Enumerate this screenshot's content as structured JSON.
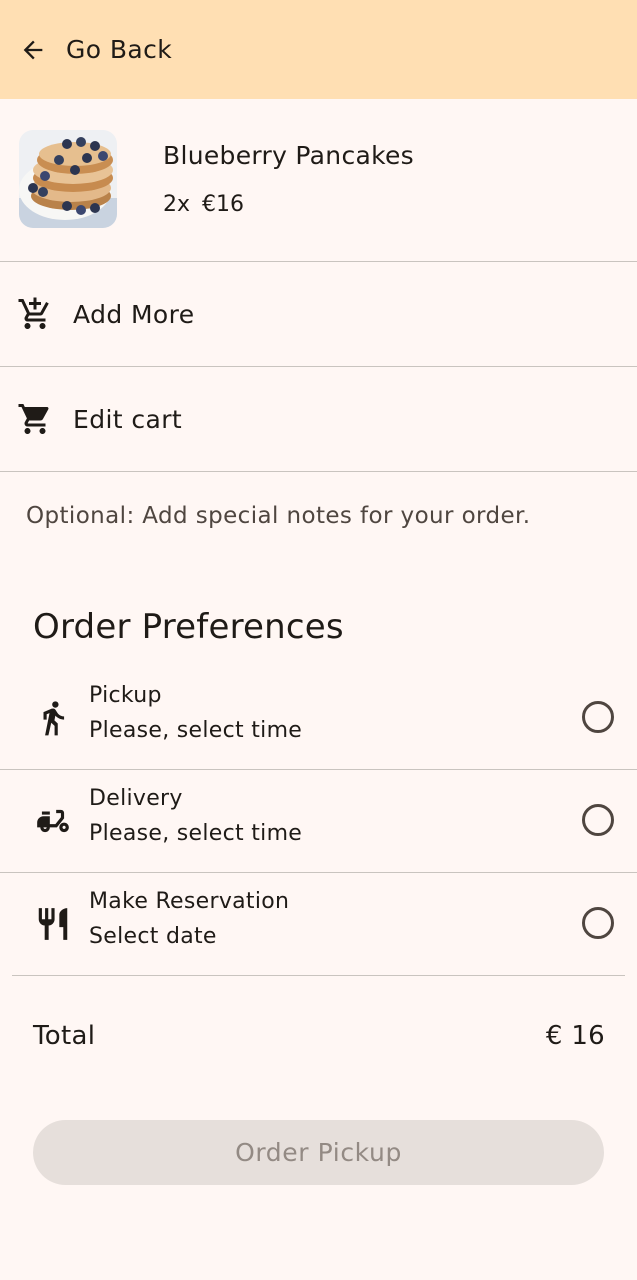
{
  "header": {
    "back_label": "Go Back"
  },
  "cart_item": {
    "name": "Blueberry Pancakes",
    "quantity": "2x",
    "price": "€16",
    "image": "blueberry-pancakes-photo"
  },
  "actions": {
    "add_more": "Add More",
    "edit_cart": "Edit cart"
  },
  "notes_placeholder": "Optional: Add special notes for your order.",
  "preferences": {
    "title": "Order Preferences",
    "options": [
      {
        "title": "Pickup",
        "subtitle": "Please, select time",
        "icon": "walking-person-icon",
        "selected": false
      },
      {
        "title": "Delivery",
        "subtitle": "Please, select time",
        "icon": "scooter-icon",
        "selected": false
      },
      {
        "title": "Make Reservation",
        "subtitle": "Select date",
        "icon": "restaurant-icon",
        "selected": false
      }
    ]
  },
  "total": {
    "label": "Total",
    "value": "€ 16"
  },
  "order_button": {
    "label": "Order Pickup",
    "enabled": false
  },
  "colors": {
    "header_bg": "#ffdfb3",
    "page_bg": "#fff7f4",
    "button_disabled_bg": "#e6dfdb",
    "button_disabled_text": "#938a84"
  }
}
